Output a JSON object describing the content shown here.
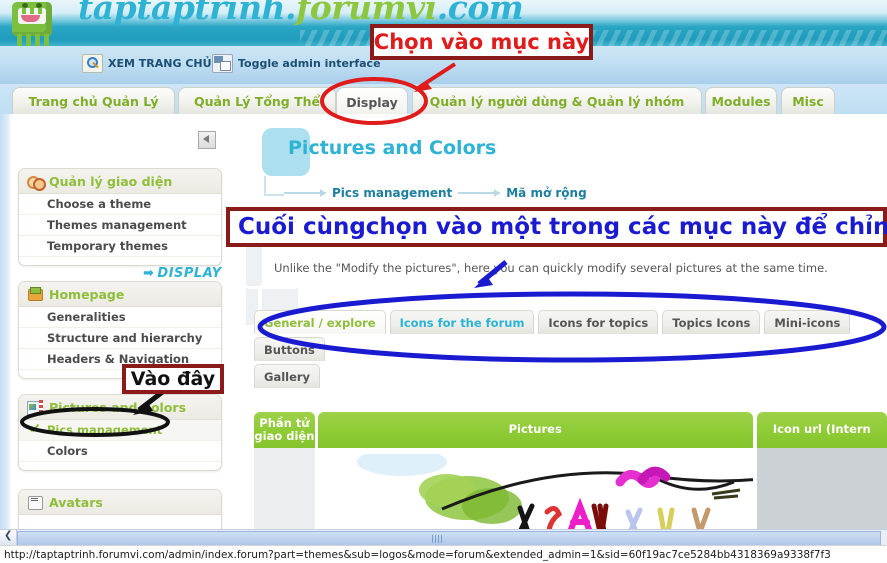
{
  "banner": {
    "site_title_parts": [
      "taptaptrinh.",
      "forumvi",
      ".com"
    ],
    "logo_icon": "green-monster-logo"
  },
  "toolbar": {
    "items": [
      {
        "label": "XEM TRANG CHỦ",
        "icon": "magnifier-icon"
      },
      {
        "label": "Toggle admin interface",
        "icon": "toggle-window-icon"
      }
    ]
  },
  "tabs": [
    {
      "label": "Trang chủ Quản Lý",
      "active": false
    },
    {
      "label": "Quản Lý Tổng Thể",
      "active": false
    },
    {
      "label": "Display",
      "active": true
    },
    {
      "label": "Quản lý người dùng & Quản lý nhóm",
      "active": false
    },
    {
      "label": "Modules",
      "active": false
    },
    {
      "label": "Misc",
      "active": false
    }
  ],
  "sidebar": {
    "display_link": "DISPLAY",
    "display_arrow": "➡",
    "collapse_icon": "collapse-left-icon",
    "panels": [
      {
        "title": "Quản lý giao diện",
        "icon": "rings-icon",
        "items": [
          {
            "label": "Choose a theme",
            "selected": false
          },
          {
            "label": "Themes management",
            "selected": false
          },
          {
            "label": "Temporary themes",
            "selected": false
          }
        ]
      },
      {
        "title": "Homepage",
        "icon": "home-box-icon",
        "items": [
          {
            "label": "Generalities",
            "selected": false
          },
          {
            "label": "Structure and hierarchy",
            "selected": false
          },
          {
            "label": "Headers & Navigation",
            "selected": false
          }
        ]
      },
      {
        "title": "Pictures and Colors",
        "icon": "pictures-icon",
        "items": [
          {
            "label": "Pics management",
            "selected": true
          },
          {
            "label": "Colors",
            "selected": false
          }
        ]
      },
      {
        "title": "Avatars",
        "icon": "avatar-icon",
        "items": []
      }
    ]
  },
  "content": {
    "page_title": "Pictures and Colors",
    "breadcrumb": [
      "Pics management",
      "Mã mở rộng"
    ],
    "description": "Unlike the \"Modify the pictures\", here you can quickly modify several pictures at the same time.",
    "inner_tabs": [
      {
        "label": "General / explore",
        "state": "active"
      },
      {
        "label": "Icons for the forum",
        "state": "highlight"
      },
      {
        "label": "Icons for topics",
        "state": "normal"
      },
      {
        "label": "Topics Icons",
        "state": "normal"
      },
      {
        "label": "Mini-icons",
        "state": "normal"
      },
      {
        "label": "Buttons",
        "state": "normal"
      },
      {
        "label": "Gallery",
        "state": "normal"
      }
    ],
    "table": {
      "headers": [
        "Phần tử giao diện",
        "Pictures",
        "Icon url (Intern"
      ],
      "row_preview": "forum-banner-image"
    }
  },
  "annotations": [
    {
      "id": "chon",
      "text": "Chọn vào mục này",
      "color": "#e01b1b",
      "border": "#8b1a1a"
    },
    {
      "id": "cuoi",
      "text": "Cuối cùngchọn vào một trong các mục này để chỉnh sửa",
      "color": "#1a1ad0",
      "border": "#8b1a1a"
    },
    {
      "id": "vao",
      "text": "Vào đây",
      "color": "#111111",
      "border": "#8b1a1a"
    }
  ],
  "status_bar": {
    "url": "http://taptaptrinh.forumvi.com/admin/index.forum?part=themes&sub=logos&mode=forum&extended_admin=1&sid=60f19ac7ce5284bb4318369a9338f7f3"
  },
  "scrollbar": {
    "left_arrow_icon": "chevron-left-icon"
  }
}
